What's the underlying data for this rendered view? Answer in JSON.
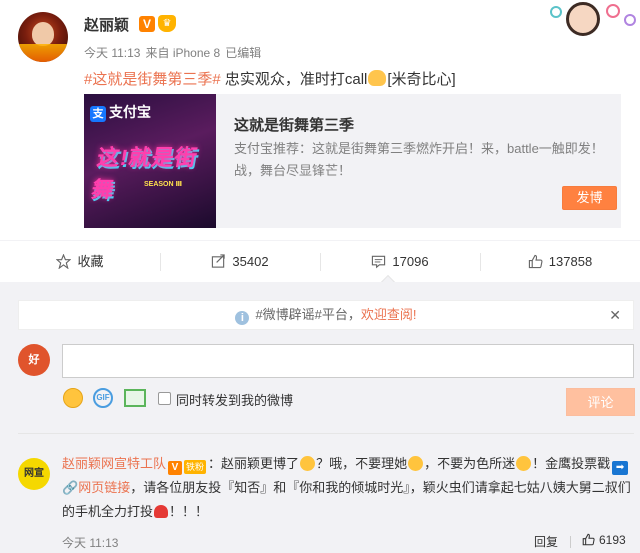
{
  "post": {
    "author": "赵丽颖",
    "vip_badge": "V",
    "crown_badge": "♛",
    "time": "今天 11:13",
    "source": "来自 iPhone 8",
    "edited": "已编辑",
    "topic": "#这就是街舞第三季#",
    "text_main": " 忠实观众，准时打call",
    "text_emoji_label": "[米奇比心]"
  },
  "card": {
    "brand": "支付宝",
    "title": "这就是街舞第三季",
    "desc": "支付宝推荐：这就是街舞第三季燃炸开启！来，battle一触即发！战，舞台尽显锋芒！",
    "button": "发博",
    "logo_text": "这!就是街舞",
    "season_text": "SEASON Ⅲ"
  },
  "actions": {
    "favorite": "收藏",
    "repost": "35402",
    "comment": "17096",
    "like": "137858"
  },
  "comments": {
    "notice_prefix": "#微博辟谣#平台，",
    "notice_link": "欢迎查阅!",
    "my_avatar_text": "好",
    "repost_option": "同时转发到我的微博",
    "submit": "评论"
  },
  "comment1": {
    "avatar_text": "网宣",
    "name": "赵丽颖网宣特工队",
    "fan_badge": "铁粉",
    "colon": "：",
    "part1": "赵丽颖更博了",
    "part2": "？哦，不要理她",
    "part3": "，不要为色所迷",
    "part4": "！金鹰投票戳",
    "link": "网页链接",
    "part5": "，请各位朋友投『知否』和『你和我的倾城时光』，颖火虫们请拿起七姑八姨大舅二叔们的手机全力打投",
    "part6": "！！！",
    "time": "今天 11:13",
    "reply": "回复",
    "likes": "6193"
  }
}
